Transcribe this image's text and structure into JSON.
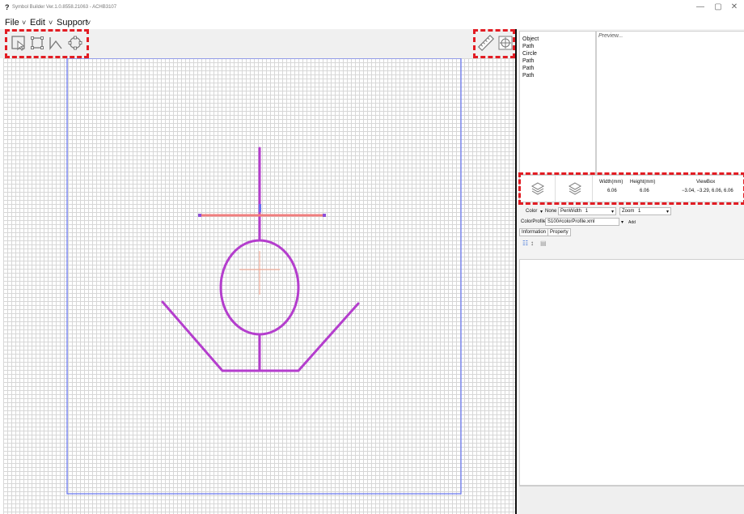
{
  "window": {
    "title": "Symbol Builder Ver.1.0.8558.21063 - ACHB3107",
    "app_icon": "question-mark-icon",
    "minimize_glyph": "—",
    "maximize_glyph": "▢",
    "close_glyph": "✕"
  },
  "menu": {
    "file": "File",
    "edit": "Edit",
    "support": "Support"
  },
  "toolbar": {
    "left_tools": [
      "select-tool-icon",
      "rectangle-tool-icon",
      "path-tool-icon",
      "circle-tool-icon"
    ],
    "right_tools": [
      "ruler-icon",
      "crosshair-target-icon"
    ]
  },
  "object_list": {
    "items": [
      "Object",
      "Path",
      "Circle",
      "Path",
      "Path",
      "Path"
    ]
  },
  "preview": {
    "label": "Preview..."
  },
  "dimensions": {
    "width_label": "Width(mm)",
    "height_label": "Height(mm)",
    "viewbox_label": "ViewBox",
    "width_value": "6.06",
    "height_value": "6.06",
    "viewbox_value": "−3.04, −3.29, 6.06, 6.06"
  },
  "properties": {
    "color_label": "Color",
    "color_value": "None",
    "penwidth_label": "PenWidth",
    "penwidth_value": "1",
    "zoom_label": "Zoom",
    "zoom_value": "1",
    "colorprofile_label": "ColorProfile",
    "colorprofile_value": "S100#colorProfile.xml",
    "add_button": "Add",
    "tabs": [
      "Information",
      "Property"
    ]
  },
  "colors": {
    "symbol_stroke": "#b43ecd",
    "selection_line": "#f07e7e",
    "page_border": "#6d7bf0",
    "highlight": "#e21c23"
  }
}
